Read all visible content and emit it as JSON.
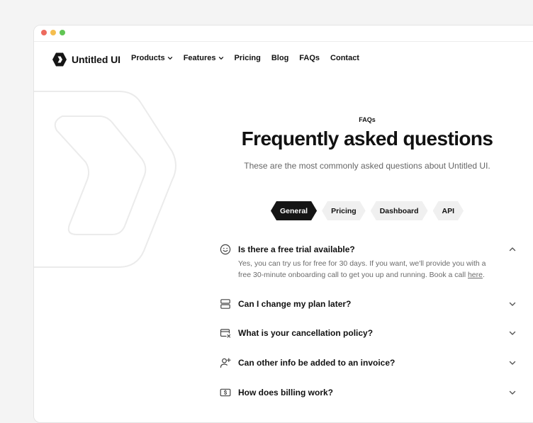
{
  "nav": {
    "brand": "Untitled UI",
    "items": [
      {
        "label": "Products",
        "has_dropdown": true
      },
      {
        "label": "Features",
        "has_dropdown": true
      },
      {
        "label": "Pricing",
        "has_dropdown": false
      },
      {
        "label": "Blog",
        "has_dropdown": false
      },
      {
        "label": "FAQs",
        "has_dropdown": false
      },
      {
        "label": "Contact",
        "has_dropdown": false
      }
    ]
  },
  "hero": {
    "eyebrow": "FAQs",
    "title": "Frequently asked questions",
    "subtitle": "These are the most commonly asked questions about Untitled UI."
  },
  "tabs": [
    {
      "label": "General",
      "active": true
    },
    {
      "label": "Pricing",
      "active": false
    },
    {
      "label": "Dashboard",
      "active": false
    },
    {
      "label": "API",
      "active": false
    }
  ],
  "faqs": [
    {
      "icon": "smiley-icon",
      "question": "Is there a free trial available?",
      "expanded": true,
      "answer_text": "Yes, you can try us for free for 30 days. If you want, we'll provide you with a free 30-minute onboarding call to get you up and running. Book a call ",
      "answer_link": "here",
      "answer_end": "."
    },
    {
      "icon": "server-icon",
      "question": "Can I change my plan later?",
      "expanded": false
    },
    {
      "icon": "card-cancel-icon",
      "question": "What is your cancellation policy?",
      "expanded": false
    },
    {
      "icon": "user-plus-icon",
      "question": "Can other info be added to an invoice?",
      "expanded": false
    },
    {
      "icon": "dollar-bill-icon",
      "question": "How does billing work?",
      "expanded": false
    }
  ],
  "colors": {
    "accent": "#151515",
    "tab_bg": "#f0f0f0",
    "muted_text": "#6b6b6b"
  }
}
